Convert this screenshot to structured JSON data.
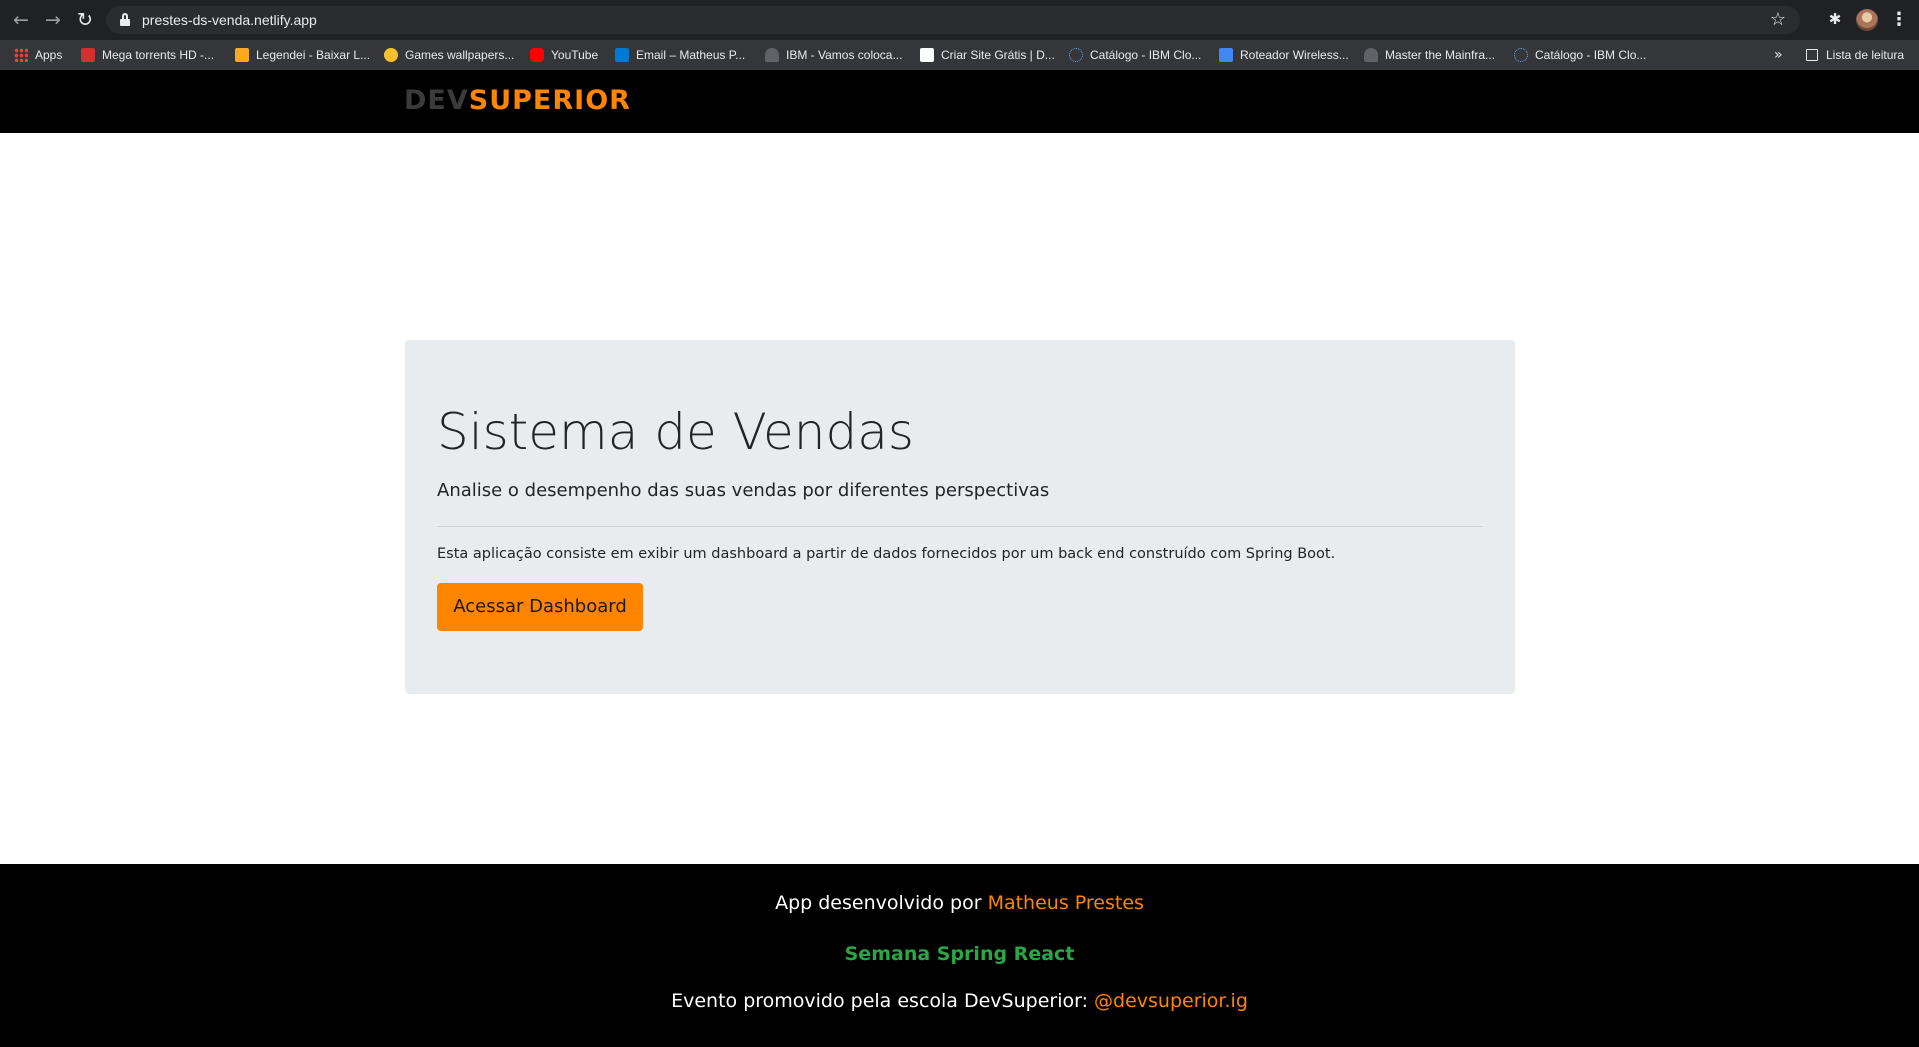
{
  "browser": {
    "url": "prestes-ds-venda.netlify.app",
    "bookmarks": [
      {
        "label": "Apps",
        "icon": "apps-grid-icon",
        "color": "#ea4335"
      },
      {
        "label": "Mega torrents HD -...",
        "icon": "hd-favicon",
        "color": "#d32f2f"
      },
      {
        "label": "Legendei - Baixar L...",
        "icon": "legendei-favicon",
        "color": "#f9a825"
      },
      {
        "label": "Games wallpapers...",
        "icon": "wallpapers-favicon",
        "color": "#fbc02d"
      },
      {
        "label": "YouTube",
        "icon": "youtube-favicon",
        "color": "#ff0000"
      },
      {
        "label": "Email – Matheus P...",
        "icon": "outlook-favicon",
        "color": "#0078d4"
      },
      {
        "label": "IBM - Vamos coloca...",
        "icon": "ibm-favicon",
        "color": "#9aa0a6"
      },
      {
        "label": "Criar Site Grátis | D...",
        "icon": "wix-favicon",
        "color": "#ffffff"
      },
      {
        "label": "Catálogo - IBM Clo...",
        "icon": "ibm-cloud-favicon",
        "color": "#6fa8dc"
      },
      {
        "label": "Roteador Wireless...",
        "icon": "router-favicon",
        "color": "#4285f4"
      },
      {
        "label": "Master the Mainfra...",
        "icon": "ibm-favicon",
        "color": "#9aa0a6"
      },
      {
        "label": "Catálogo - IBM Clo...",
        "icon": "ibm-cloud-favicon",
        "color": "#6fa8dc"
      }
    ],
    "more_label": "»",
    "reading_list": "Lista de leitura"
  },
  "header": {
    "logo_dev": "DEV",
    "logo_superior": "SUPERIOR"
  },
  "jumbotron": {
    "title": "Sistema de Vendas",
    "lead": "Analise o desempenho das suas vendas por diferentes perspectivas",
    "description": "Esta aplicação consiste em exibir um dashboard a partir de dados fornecidos por um back end construído com Spring Boot.",
    "button_label": "Acessar Dashboard"
  },
  "footer": {
    "line1_prefix": "App desenvolvido por ",
    "line1_author": "Matheus Prestes",
    "line2": "Semana Spring React",
    "line3_prefix": "Evento promovido pela escola DevSuperior: ",
    "line3_handle": "@devsuperior.ig"
  },
  "colors": {
    "brand_orange": "#ff8400",
    "event_green": "#28a745",
    "jumbotron_bg": "#e9ecef",
    "header_bg": "#000000"
  }
}
